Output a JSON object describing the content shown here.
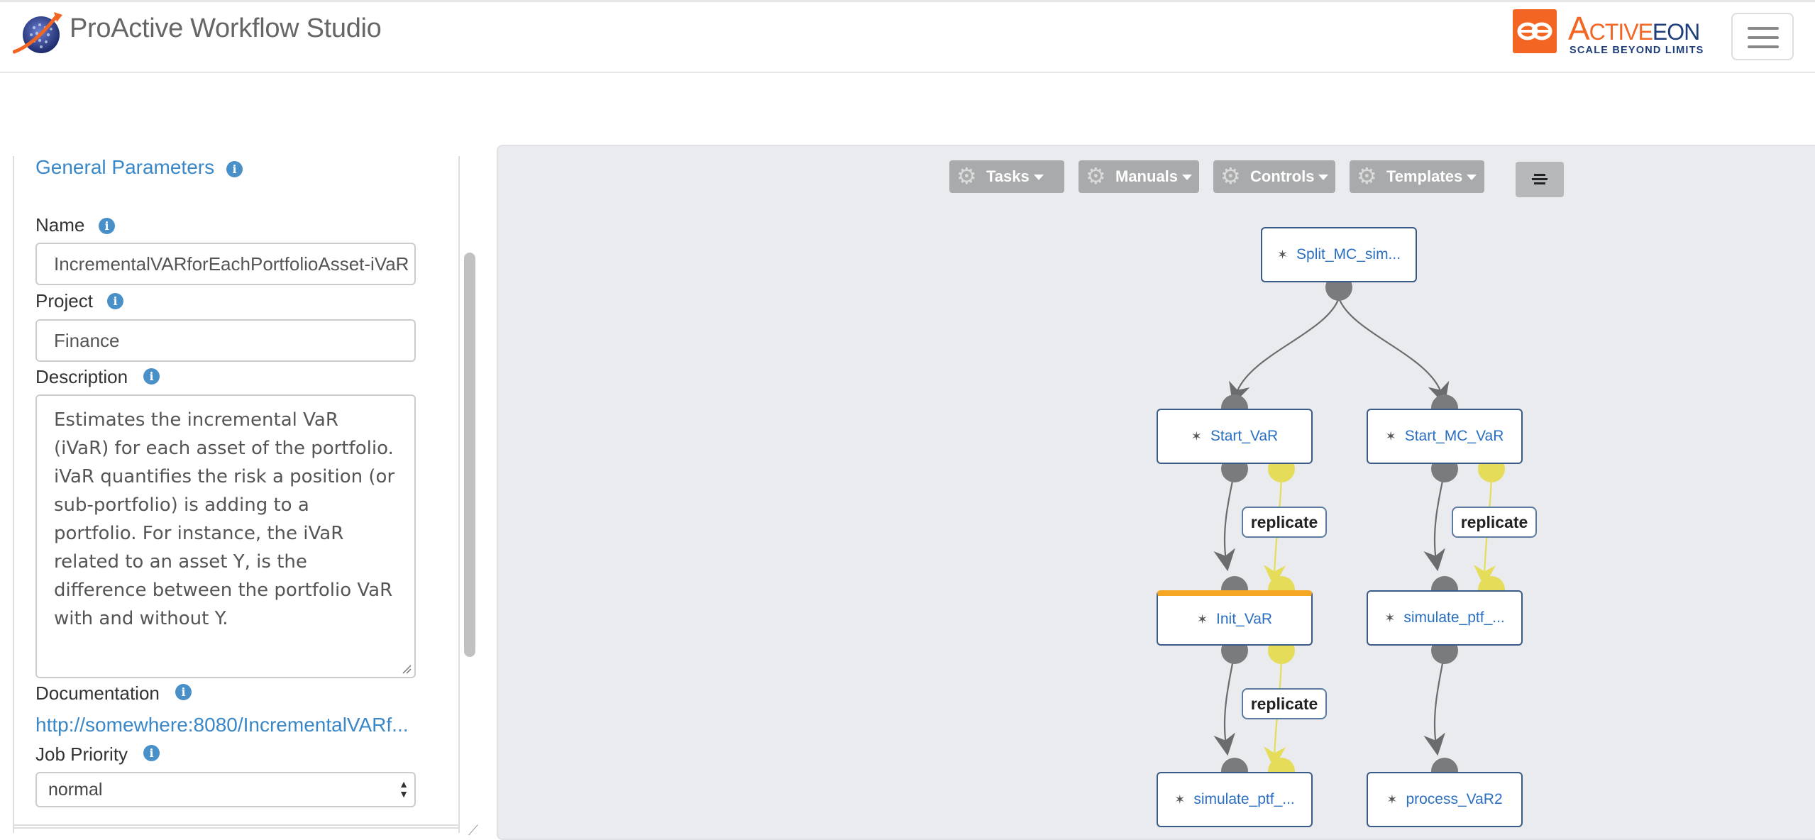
{
  "header": {
    "app_title": "ProActive Workflow Studio",
    "brand_name_a": "Active",
    "brand_name_b": "eon",
    "brand_tagline": "SCALE BEYOND LIMITS"
  },
  "panel": {
    "section_title": "General Parameters",
    "name_label": "Name",
    "name_value": "IncrementalVARforEachPortfolioAsset-iVaR",
    "project_label": "Project",
    "project_value": "Finance",
    "description_label": "Description",
    "description_value": "Estimates the incremental VaR (iVaR) for each asset of the portfolio. iVaR quantifies the risk a position (or sub-portfolio) is adding to a portfolio. For instance, the iVaR related to an asset Y, is the difference between the portfolio VaR with and without Y.",
    "documentation_label": "Documentation",
    "documentation_value": "http://somewhere:8080/IncrementalVARf...",
    "priority_label": "Job Priority",
    "priority_value": "normal",
    "info_glyph": "i"
  },
  "toolbar": {
    "tasks": "Tasks",
    "manuals": "Manuals",
    "controls": "Controls",
    "templates": "Templates"
  },
  "workflow": {
    "tasks": {
      "split": "Split_MC_sim...",
      "start_var": "Start_VaR",
      "start_mc_var": "Start_MC_VaR",
      "init_var": "Init_VaR",
      "simulate_right": "simulate_ptf_...",
      "simulate_left": "simulate_ptf_...",
      "process_var2": "process_VaR2"
    },
    "replicate_label": "replicate"
  },
  "colors": {
    "link": "#3a87c8",
    "brand_orange": "#f26522",
    "brand_navy": "#1e3d7b",
    "running_bar": "#f5a623",
    "replicate_edge": "#e5dc5a",
    "flow_edge": "#6b6c6d"
  },
  "icons": [
    "globe-logo-icon",
    "activeeon-logo-icon",
    "menu-icon",
    "info-icon",
    "gear-icon",
    "caret-down-icon",
    "align-icon",
    "task-icon",
    "resize-grip-icon",
    "select-arrows-icon"
  ]
}
